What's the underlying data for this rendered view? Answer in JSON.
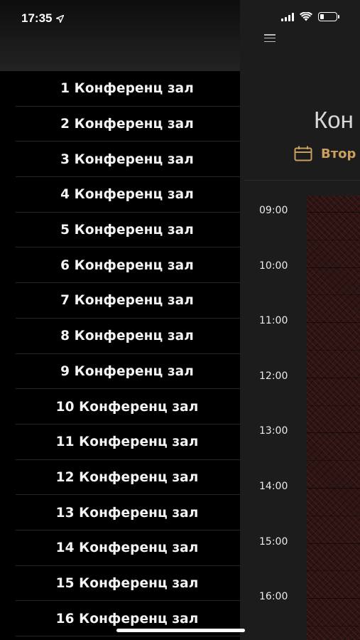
{
  "status_bar": {
    "time": "17:35",
    "location_icon": "location-arrow-icon",
    "signal_icon": "cellular-signal-icon",
    "wifi_icon": "wifi-icon",
    "battery_icon": "battery-icon",
    "battery_level": 0.25
  },
  "header": {
    "menu_icon": "hamburger-menu-icon"
  },
  "page": {
    "title": "Кон",
    "date_icon": "calendar-icon",
    "date_text": "Втор",
    "accent_color": "#c9a05d"
  },
  "schedule": {
    "times": [
      "09:00",
      "10:00",
      "11:00",
      "12:00",
      "13:00",
      "14:00",
      "15:00",
      "16:00"
    ],
    "busy_color": "#2a1514"
  },
  "drawer": {
    "rooms": [
      {
        "label": "1 Конференц зал"
      },
      {
        "label": "2 Конференц зал"
      },
      {
        "label": "3 Конференц зал"
      },
      {
        "label": "4 Конференц зал"
      },
      {
        "label": "5 Конференц зал"
      },
      {
        "label": "6 Конференц зал"
      },
      {
        "label": "7 Конференц зал"
      },
      {
        "label": "8 Конференц зал"
      },
      {
        "label": "9 Конференц зал"
      },
      {
        "label": "10 Конференц зал"
      },
      {
        "label": "11 Конференц зал"
      },
      {
        "label": "12 Конференц зал"
      },
      {
        "label": "13 Конференц зал"
      },
      {
        "label": "14 Конференц зал"
      },
      {
        "label": "15 Конференц зал"
      },
      {
        "label": "16 Конференц зал"
      }
    ]
  }
}
